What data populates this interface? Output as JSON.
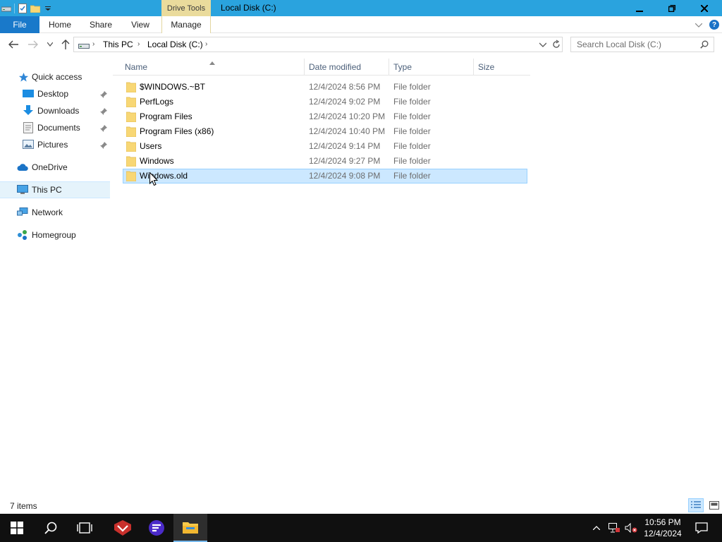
{
  "window": {
    "title": "Local Disk (C:)",
    "context_tab_group": "Drive Tools"
  },
  "ribbon": {
    "tabs": [
      {
        "label": "File"
      },
      {
        "label": "Home"
      },
      {
        "label": "Share"
      },
      {
        "label": "View"
      },
      {
        "label": "Manage"
      }
    ]
  },
  "address": {
    "crumbs": [
      "This PC",
      "Local Disk (C:)"
    ]
  },
  "search": {
    "placeholder": "Search Local Disk (C:)"
  },
  "nav": {
    "items": [
      {
        "label": "Quick access",
        "icon": "star-icon"
      },
      {
        "label": "Desktop",
        "icon": "desktop-icon",
        "pinned": true
      },
      {
        "label": "Downloads",
        "icon": "download-icon",
        "pinned": true
      },
      {
        "label": "Documents",
        "icon": "documents-icon",
        "pinned": true
      },
      {
        "label": "Pictures",
        "icon": "pictures-icon",
        "pinned": true
      },
      {
        "label": "OneDrive",
        "icon": "cloud-icon"
      },
      {
        "label": "This PC",
        "icon": "computer-icon",
        "selected": true
      },
      {
        "label": "Network",
        "icon": "network-icon"
      },
      {
        "label": "Homegroup",
        "icon": "homegroup-icon"
      }
    ]
  },
  "columns": {
    "name": "Name",
    "date": "Date modified",
    "type": "Type",
    "size": "Size"
  },
  "files": [
    {
      "name": "$WINDOWS.~BT",
      "date": "12/4/2024 8:56 PM",
      "type": "File folder",
      "size": ""
    },
    {
      "name": "PerfLogs",
      "date": "12/4/2024 9:02 PM",
      "type": "File folder",
      "size": ""
    },
    {
      "name": "Program Files",
      "date": "12/4/2024 10:20 PM",
      "type": "File folder",
      "size": ""
    },
    {
      "name": "Program Files (x86)",
      "date": "12/4/2024 10:40 PM",
      "type": "File folder",
      "size": ""
    },
    {
      "name": "Users",
      "date": "12/4/2024 9:14 PM",
      "type": "File folder",
      "size": ""
    },
    {
      "name": "Windows",
      "date": "12/4/2024 9:27 PM",
      "type": "File folder",
      "size": ""
    },
    {
      "name": "Windows.old",
      "date": "12/4/2024 9:08 PM",
      "type": "File folder",
      "size": "",
      "selected": true
    }
  ],
  "status": {
    "item_count": "7 items"
  },
  "taskbar": {
    "time": "10:56 PM",
    "date": "12/4/2024"
  },
  "colors": {
    "titlebar": "#2aa3de",
    "file_tab": "#1979ca",
    "context_tab": "#eadb9c",
    "selection": "#cce8ff",
    "folder": "#f8d775",
    "taskbar": "#101010"
  }
}
